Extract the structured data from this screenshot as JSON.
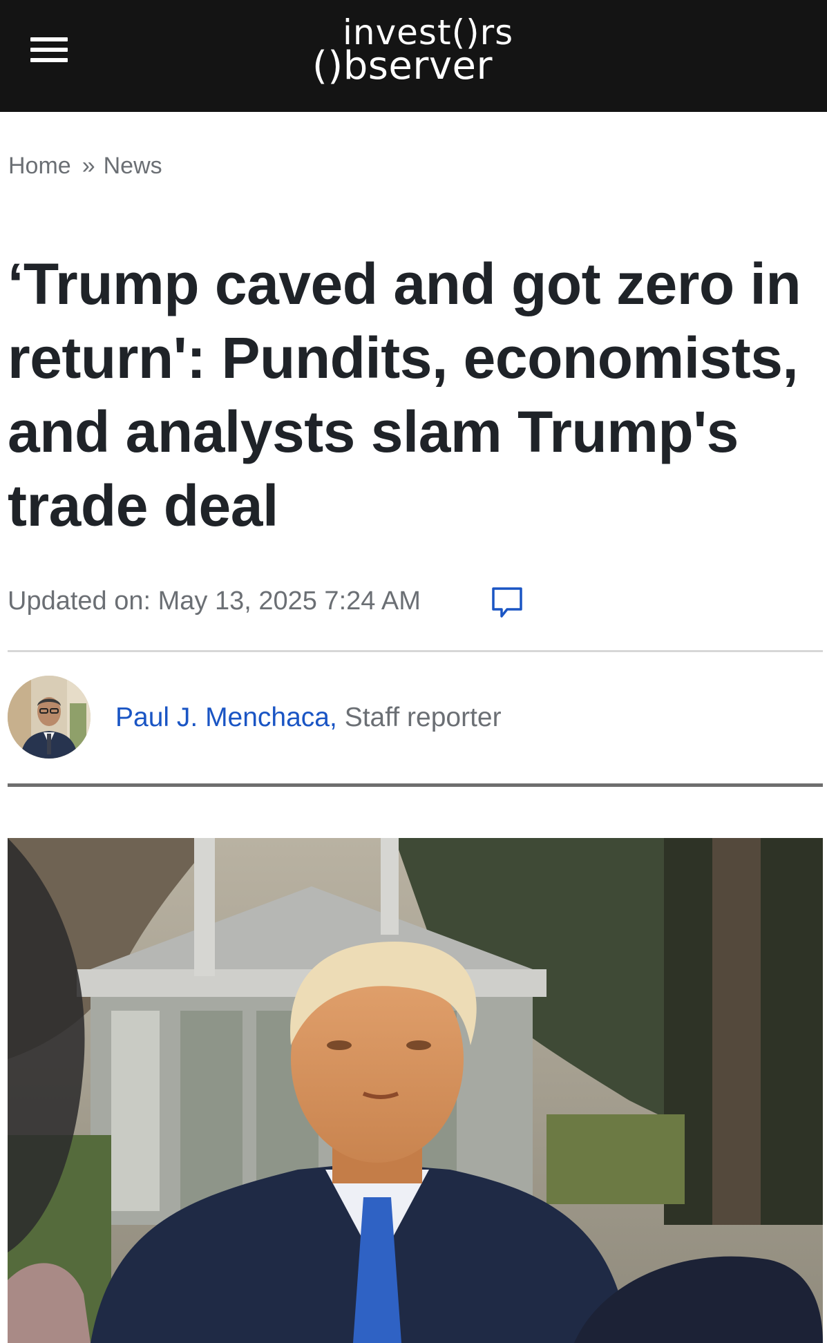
{
  "header": {
    "logo_line1": "invest()rs",
    "logo_line2": "()bserver",
    "background": "#141414"
  },
  "breadcrumb": {
    "home": "Home",
    "separator": "»",
    "section": "News"
  },
  "article": {
    "headline": "‘Trump caved and got zero in return': Pundits, economists, and analysts slam Trump's trade deal",
    "updated": "Updated on: May 13, 2025 7:24 AM",
    "comment_icon": "comment-icon"
  },
  "author": {
    "name": "Paul J. Menchaca,",
    "role": "Staff reporter",
    "link_color": "#1a55c4"
  },
  "hero_image": {
    "icon": "photo"
  }
}
